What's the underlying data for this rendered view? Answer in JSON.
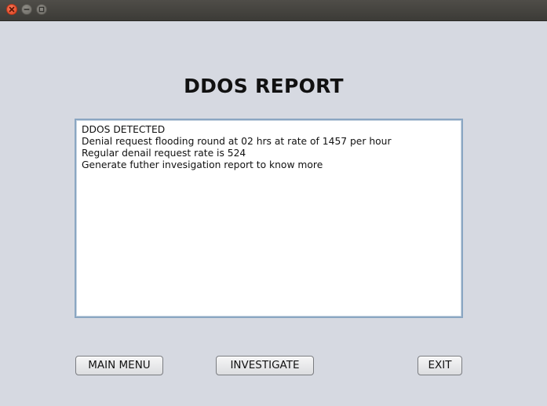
{
  "window": {
    "controls": [
      "close-icon",
      "minimize-icon",
      "maximize-icon"
    ],
    "colors": {
      "close": "#e0431f",
      "titlebar": "#3c3b37",
      "background": "#d6d9e1"
    }
  },
  "report": {
    "title": "DDOS REPORT",
    "lines": [
      "DDOS DETECTED",
      "Denial request flooding round at 02 hrs at rate of 1457 per hour",
      "Regular denail request rate is 524",
      "Generate futher invesigation report to know more"
    ]
  },
  "buttons": {
    "main_menu": "MAIN MENU",
    "investigate": "INVESTIGATE",
    "exit": "EXIT"
  }
}
